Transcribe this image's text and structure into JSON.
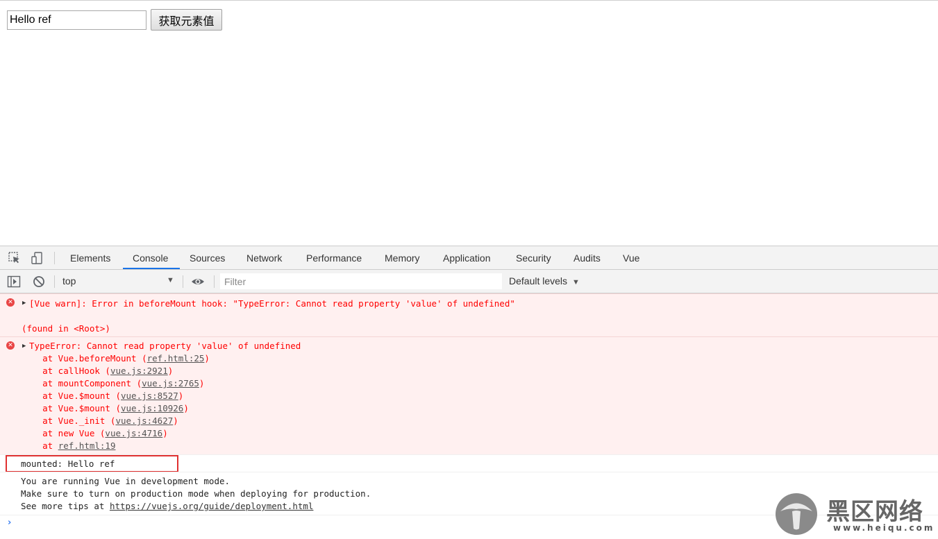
{
  "page": {
    "input_value": "Hello ref",
    "button_label": "获取元素值"
  },
  "devtools": {
    "tabs": [
      {
        "label": "Elements"
      },
      {
        "label": "Console"
      },
      {
        "label": "Sources"
      },
      {
        "label": "Network"
      },
      {
        "label": "Performance"
      },
      {
        "label": "Memory"
      },
      {
        "label": "Application"
      },
      {
        "label": "Security"
      },
      {
        "label": "Audits"
      },
      {
        "label": "Vue"
      }
    ],
    "active_tab": "Console",
    "context": "top",
    "filter_placeholder": "Filter",
    "levels_label": "Default levels",
    "levels_arrow": "▼",
    "context_arrow": "▼"
  },
  "console": {
    "error1": {
      "line1": "[Vue warn]: Error in beforeMount hook: \"TypeError: Cannot read property 'value' of undefined\"",
      "line2": "(found in <Root>)"
    },
    "error2": {
      "head": "TypeError: Cannot read property 'value' of undefined",
      "frames": [
        {
          "prefix": "    at Vue.beforeMount (",
          "link": "ref.html:25",
          "suffix": ")"
        },
        {
          "prefix": "    at callHook (",
          "link": "vue.js:2921",
          "suffix": ")"
        },
        {
          "prefix": "    at mountComponent (",
          "link": "vue.js:2765",
          "suffix": ")"
        },
        {
          "prefix": "    at Vue.$mount (",
          "link": "vue.js:8527",
          "suffix": ")"
        },
        {
          "prefix": "    at Vue.$mount (",
          "link": "vue.js:10926",
          "suffix": ")"
        },
        {
          "prefix": "    at Vue._init (",
          "link": "vue.js:4627",
          "suffix": ")"
        },
        {
          "prefix": "    at new Vue (",
          "link": "vue.js:4716",
          "suffix": ")"
        },
        {
          "prefix": "    at ",
          "link": "ref.html:19",
          "suffix": ""
        }
      ]
    },
    "mounted_log": "mounted: Hello ref",
    "info": {
      "line1": "You are running Vue in development mode.",
      "line2": "Make sure to turn on production mode when deploying for production.",
      "line3_prefix": "See more tips at ",
      "line3_link": "https://vuejs.org/guide/deployment.html"
    },
    "prompt": "›"
  },
  "watermark": {
    "text": "黑区网络",
    "url": "www.heiqu.com"
  },
  "colors": {
    "error_bg": "#fff0f0",
    "error_text": "#ff0000",
    "accent": "#1a73e8",
    "highlight_box": "#e03030"
  }
}
